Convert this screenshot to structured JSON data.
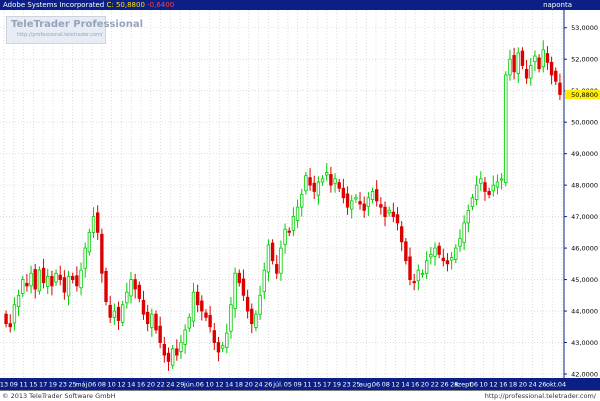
{
  "header": {
    "title": "Adobe Systems Incorporated",
    "close_label": "C: 50,8800",
    "change": "-0,6400",
    "period": "naponta"
  },
  "logo": {
    "name": "TeleTrader Professional",
    "url": "http://professional.teletrader.com/"
  },
  "footer": {
    "copyright": "© 2013 TeleTrader Software GmbH",
    "url": "http://professional.teletrader.com/"
  },
  "colors": {
    "up": "#00cc00",
    "down": "#dd0000",
    "current_price_bg": "#ffee00",
    "header_bg": "#0b1f86",
    "axis_bg": "#0b1f86"
  },
  "chart_data": {
    "type": "candlestick",
    "title": "",
    "xlabel": "",
    "ylabel": "",
    "ylim": [
      42.0,
      53.5
    ],
    "yticks": [
      42,
      43,
      44,
      45,
      46,
      47,
      48,
      49,
      50,
      51,
      52,
      53
    ],
    "ytick_labels": [
      "42,0000",
      "43,0000",
      "44,0000",
      "45,0000",
      "46,0000",
      "47,0000",
      "48,0000",
      "49,0000",
      "50,0000",
      "51,0000",
      "52,0000",
      "53,0000"
    ],
    "current_price": 50.88,
    "current_price_label": "50,8800",
    "grid": true,
    "x_tick_labels": [
      "13",
      "09",
      "11",
      "15",
      "17",
      "19",
      "23",
      "25",
      "máj.",
      "06",
      "08",
      "10",
      "12",
      "14",
      "16",
      "20",
      "22",
      "24",
      "29",
      "jún.",
      "06",
      "10",
      "12",
      "14",
      "18",
      "20",
      "24",
      "26",
      "júl.",
      "05",
      "09",
      "11",
      "15",
      "17",
      "19",
      "23",
      "25",
      "aug.",
      "06",
      "08",
      "12",
      "14",
      "16",
      "20",
      "22",
      "26",
      "28",
      "szept.",
      "06",
      "10",
      "12",
      "16",
      "18",
      "20",
      "24",
      "26",
      "okt.",
      "04"
    ],
    "closes": [
      43.6,
      43.5,
      44.2,
      44.5,
      45.0,
      44.8,
      45.2,
      44.7,
      45.3,
      44.9,
      45.1,
      44.8,
      45.2,
      45.0,
      44.6,
      45.1,
      45.0,
      44.8,
      45.3,
      46.0,
      46.5,
      47.0,
      46.5,
      45.2,
      44.3,
      43.8,
      44.0,
      43.7,
      44.2,
      44.6,
      45.0,
      44.7,
      44.4,
      43.9,
      43.6,
      43.9,
      43.4,
      43.0,
      42.6,
      42.4,
      42.8,
      42.6,
      43.0,
      43.4,
      43.8,
      44.6,
      44.2,
      44.0,
      43.8,
      43.5,
      43.0,
      42.7,
      42.9,
      43.3,
      44.2,
      45.2,
      44.9,
      44.5,
      44.0,
      43.6,
      43.9,
      44.5,
      45.3,
      46.1,
      45.6,
      45.2,
      46.0,
      46.6,
      46.5,
      47.0,
      47.3,
      47.7,
      48.3,
      48.0,
      47.8,
      48.1,
      48.2,
      48.4,
      48.0,
      48.2,
      47.9,
      47.6,
      47.3,
      47.5,
      47.6,
      47.4,
      47.2,
      47.6,
      47.8,
      47.5,
      47.3,
      47.0,
      47.2,
      47.0,
      46.8,
      46.2,
      45.6,
      45.0,
      44.9,
      45.3,
      45.2,
      45.6,
      45.8,
      46.0,
      45.8,
      45.6,
      45.5,
      45.7,
      46.0,
      46.3,
      46.8,
      47.2,
      47.6,
      48.0,
      48.2,
      47.8,
      47.7,
      48.0,
      48.1,
      48.2,
      51.5,
      52.0,
      51.6,
      52.2,
      51.8,
      51.4,
      51.8,
      52.1,
      51.7,
      52.3,
      51.9,
      51.5,
      51.3,
      50.88
    ]
  }
}
